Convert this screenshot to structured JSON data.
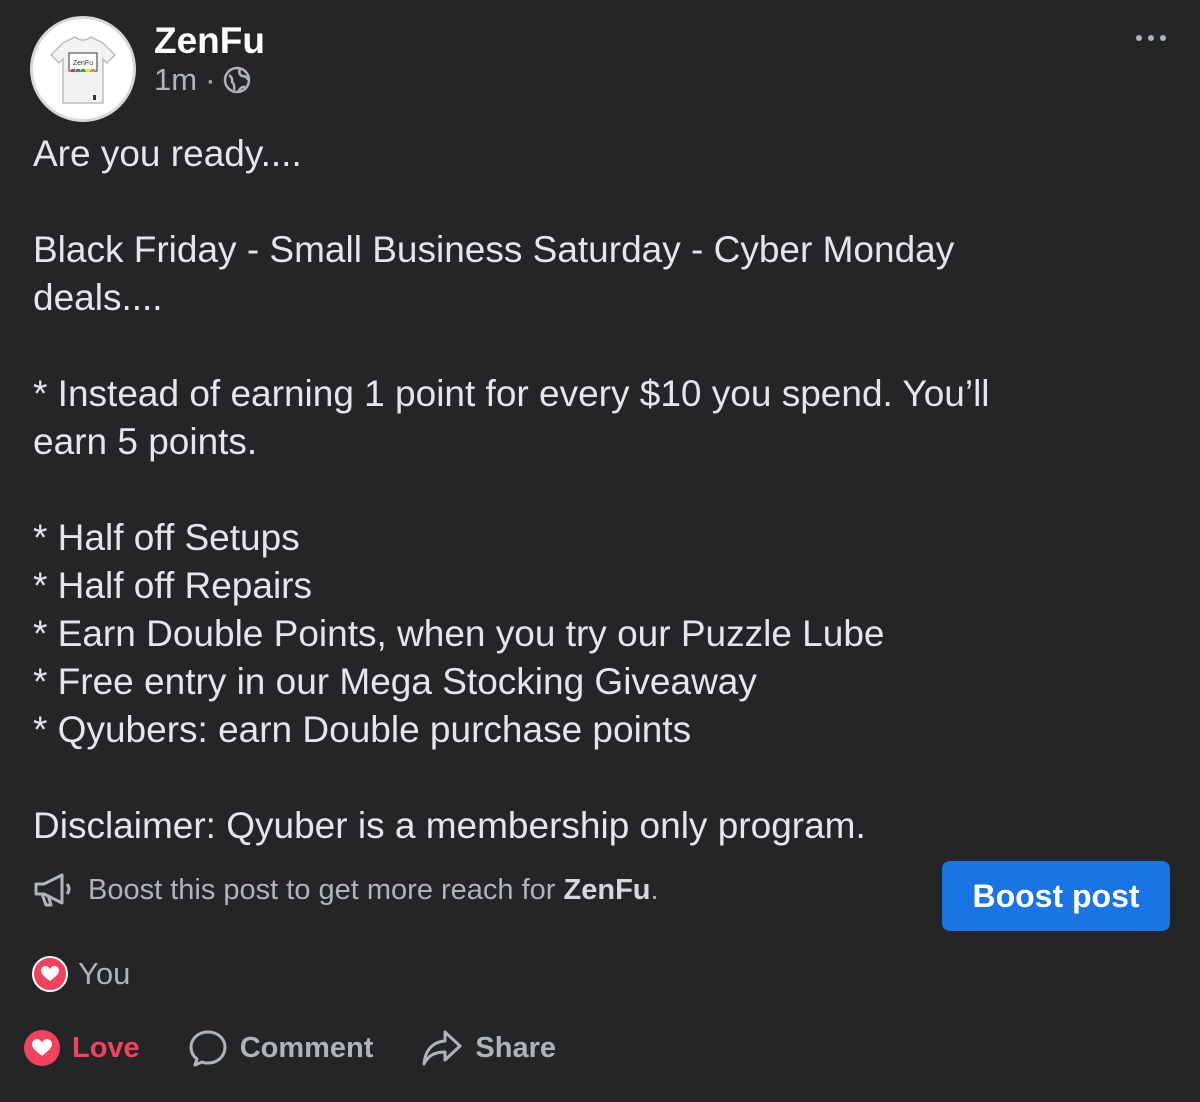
{
  "post": {
    "author": "ZenFu",
    "time": "1m",
    "separator": "·",
    "privacy_icon": "globe-icon",
    "more_icon": "more-horizontal-icon",
    "avatar_text": "ZenFu",
    "lines": {
      "l1": "Are you ready....",
      "l2": "Black Friday - Small Business Saturday - Cyber Monday",
      "l3": "deals....",
      "l4": "* Instead of earning  1 point for every $10 you spend. You’ll",
      "l5": "earn 5 points.",
      "l6": "* Half off Setups",
      "l7": "* Half off Repairs",
      "l8": "* Earn Double Points, when you try our Puzzle Lube",
      "l9": "* Free entry in our Mega Stocking Giveaway",
      "l10": "* Qyubers: earn Double purchase points",
      "l11": "Disclaimer: Qyuber is a membership only program."
    }
  },
  "boost": {
    "prefix": "Boost this post to get more reach for ",
    "page_name": "ZenFu",
    "suffix": ".",
    "button_label": "Boost post",
    "icon": "megaphone-icon"
  },
  "reactions": {
    "icon": "love-reaction-icon",
    "label": "You"
  },
  "actions": {
    "love": "Love",
    "comment": "Comment",
    "share": "Share"
  },
  "colors": {
    "background": "#242526",
    "accent": "#1b74e4",
    "love": "#f3425f",
    "secondary_text": "#b0b3b8"
  }
}
